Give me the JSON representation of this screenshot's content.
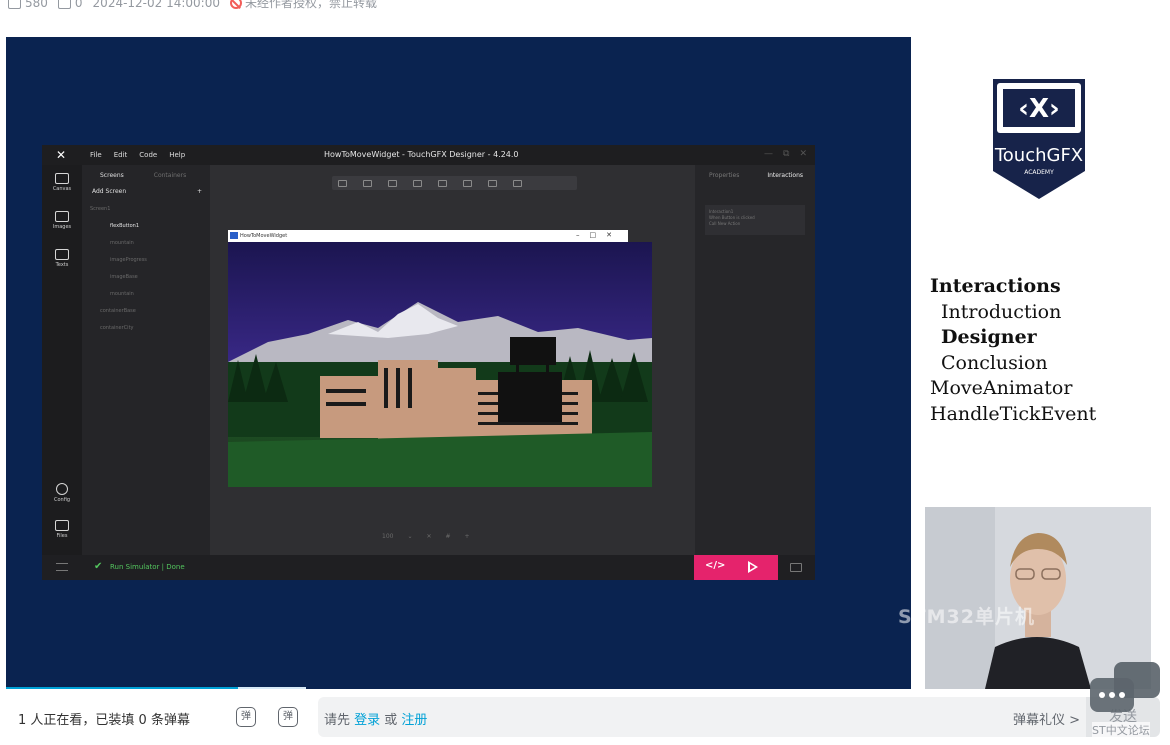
{
  "meta": {
    "plays": "580",
    "comments": "0",
    "datetime": "2024-12-02 14:00:00",
    "copyright_notice": "未经作者授权，禁止转载"
  },
  "designer": {
    "app_title": "HowToMoveWidget - TouchGFX Designer - 4.24.0",
    "menu": [
      "File",
      "Edit",
      "Code",
      "Help"
    ],
    "sidebar": [
      "Canvas",
      "Images",
      "Texts",
      "Config",
      "Files"
    ],
    "tree_tabs": {
      "screens": "Screens",
      "containers": "Containers"
    },
    "add_screen": "Add Screen",
    "tree_nodes": [
      "Screen1",
      "flexButton1",
      "mountain",
      "imageProgress",
      "imageBase",
      "mountain",
      "containerBase",
      "containerCity"
    ],
    "right_tabs": {
      "properties": "Properties",
      "interactions": "Interactions"
    },
    "interaction_card": [
      "Interaction1",
      "When Button is clicked",
      "Call New Action"
    ],
    "simulator_title": "HowToMoveWidget",
    "run_status": "Run Simulator  |  Done",
    "zoom": "100"
  },
  "slide": {
    "logo_text_main": "TouchGFX",
    "logo_text_sub": "ACADEMY",
    "topics": [
      {
        "label": "Interactions",
        "level": 1,
        "bold": true
      },
      {
        "label": "Introduction",
        "level": 2,
        "bold": false
      },
      {
        "label": "Designer",
        "level": 2,
        "bold": true
      },
      {
        "label": "Conclusion",
        "level": 2,
        "bold": false
      },
      {
        "label": "MoveAnimator",
        "level": 1,
        "bold": false
      },
      {
        "label": "HandleTickEvent",
        "level": 1,
        "bold": false
      }
    ]
  },
  "watermark": "STM32单片机",
  "danmaku": {
    "viewer_status": "1 人正在看，已装填 0 条弹幕",
    "toggle_icon_label": "弹",
    "settings_icon_label": "弹",
    "placeholder_prefix": "请先 ",
    "login_link": "登录",
    "or_text": " 或 ",
    "register_link": "注册",
    "etiquette": "弹幕礼仪 >",
    "send": "发送"
  },
  "forum_label": "ST中文论坛",
  "colors": {
    "accent_blue": "#00a1d6",
    "video_bg": "#0a2350",
    "touchgfx_navy": "#17234a",
    "sim_pink": "#e5236c"
  }
}
